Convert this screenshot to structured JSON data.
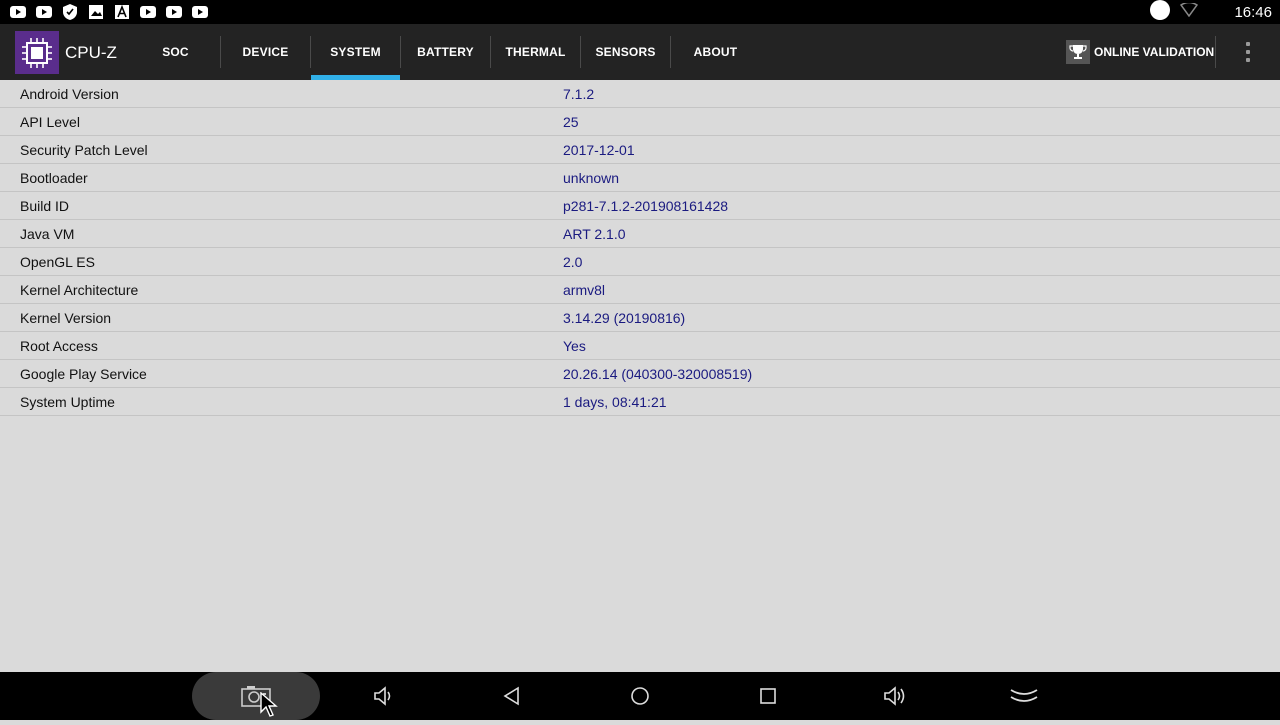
{
  "status_bar": {
    "time": "16:46",
    "notification_icons": [
      "youtube-icon",
      "youtube-icon",
      "shield-icon",
      "image-icon",
      "app-a-icon",
      "youtube-icon",
      "youtube-icon",
      "youtube-icon"
    ]
  },
  "app_bar": {
    "title": "CPU-Z",
    "tabs": [
      {
        "label": "SOC"
      },
      {
        "label": "DEVICE"
      },
      {
        "label": "SYSTEM"
      },
      {
        "label": "BATTERY"
      },
      {
        "label": "THERMAL"
      },
      {
        "label": "SENSORS"
      },
      {
        "label": "ABOUT"
      }
    ],
    "active_tab": "SYSTEM",
    "validation_label": "ONLINE VALIDATION"
  },
  "system": {
    "rows": [
      {
        "label": "Android Version",
        "value": "7.1.2"
      },
      {
        "label": "API Level",
        "value": "25"
      },
      {
        "label": "Security Patch Level",
        "value": "2017-12-01"
      },
      {
        "label": "Bootloader",
        "value": "unknown"
      },
      {
        "label": "Build ID",
        "value": "p281-7.1.2-201908161428"
      },
      {
        "label": "Java VM",
        "value": "ART 2.1.0"
      },
      {
        "label": "OpenGL ES",
        "value": "2.0"
      },
      {
        "label": "Kernel Architecture",
        "value": "armv8l"
      },
      {
        "label": "Kernel Version",
        "value": "3.14.29 (20190816)"
      },
      {
        "label": "Root Access",
        "value": "Yes"
      },
      {
        "label": "Google Play Service",
        "value": "20.26.14 (040300-320008519)"
      },
      {
        "label": "System Uptime",
        "value": "1 days, 08:41:21"
      }
    ]
  },
  "colors": {
    "active_tab_indicator": "#31b0e8",
    "value_text": "#1a1a80",
    "app_bar_bg": "#232323",
    "logo_bg": "#5a2d8c"
  }
}
